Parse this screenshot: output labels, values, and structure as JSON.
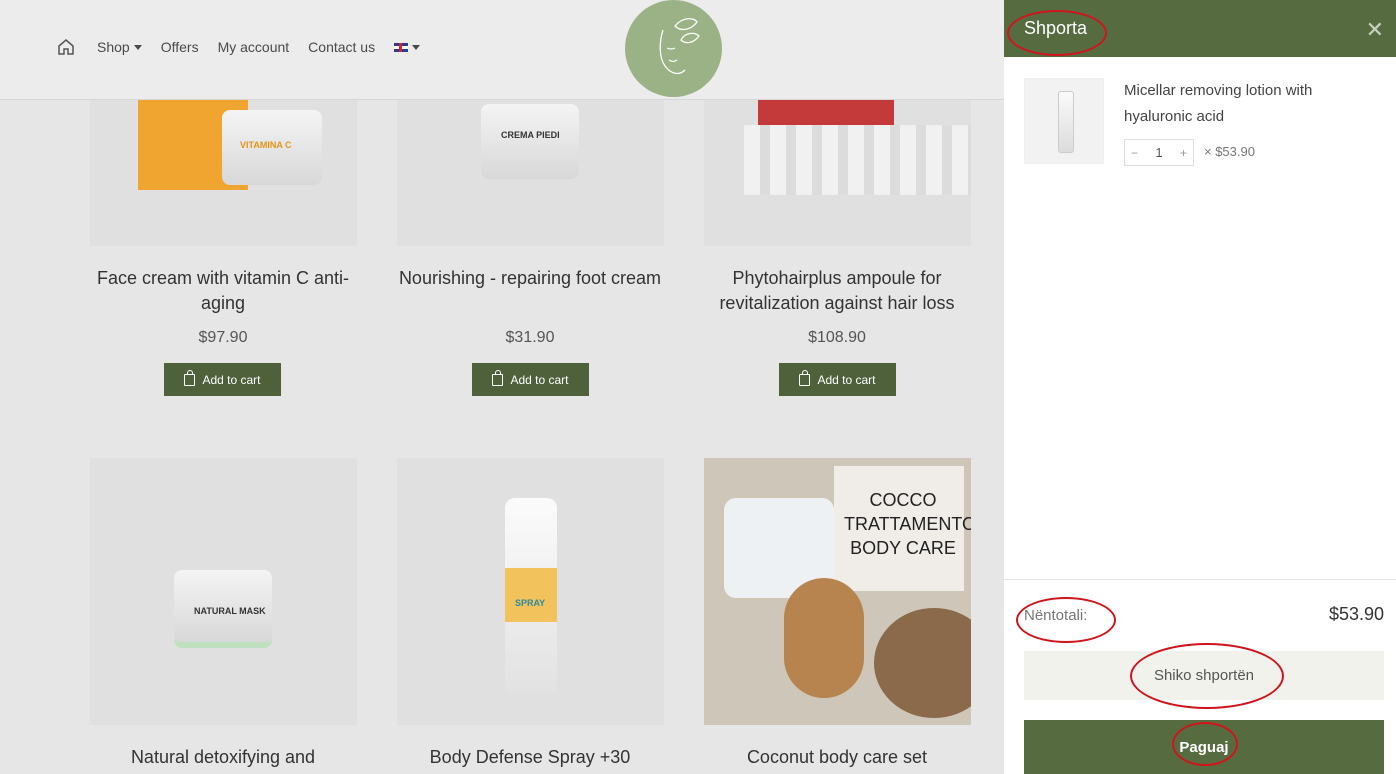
{
  "nav": {
    "items": [
      {
        "label": "Shop",
        "has_caret": true
      },
      {
        "label": "Offers"
      },
      {
        "label": "My account"
      },
      {
        "label": "Contact us"
      }
    ]
  },
  "products": [
    {
      "title": "Face cream with vitamin C anti-aging",
      "price": "$97.90",
      "button": "Add to cart",
      "image_text": "VITAMINA C"
    },
    {
      "title": "Nourishing - repairing foot cream",
      "price": "$31.90",
      "button": "Add to cart",
      "image_text": "CREMA PIEDI"
    },
    {
      "title": "Phytohairplus ampoule for revitalization against hair loss",
      "price": "$108.90",
      "button": "Add to cart",
      "image_text": ""
    },
    {
      "title": "Natural detoxifying and",
      "image_text": "NATURAL MASK"
    },
    {
      "title": "Body Defense Spray +30",
      "image_text": "SPRAY"
    },
    {
      "title": "Coconut body care set",
      "image_text": "COCCO TRATTAMENTO BODY CARE"
    }
  ],
  "cart": {
    "title": "Shporta",
    "close": "✕",
    "item": {
      "name": "Micellar removing lotion with hyaluronic acid",
      "qty": "1",
      "minus": "−",
      "plus": "+",
      "unit_price": "× $53.90"
    },
    "subtotal_label": "Nëntotali:",
    "subtotal_value": "$53.90",
    "view_cart": "Shiko shportën",
    "checkout": "Paguaj"
  },
  "colors": {
    "brand_green": "#566c40",
    "button_green": "#4e613a",
    "logo_green": "#9bb287",
    "annotation_red": "#d0141c"
  }
}
